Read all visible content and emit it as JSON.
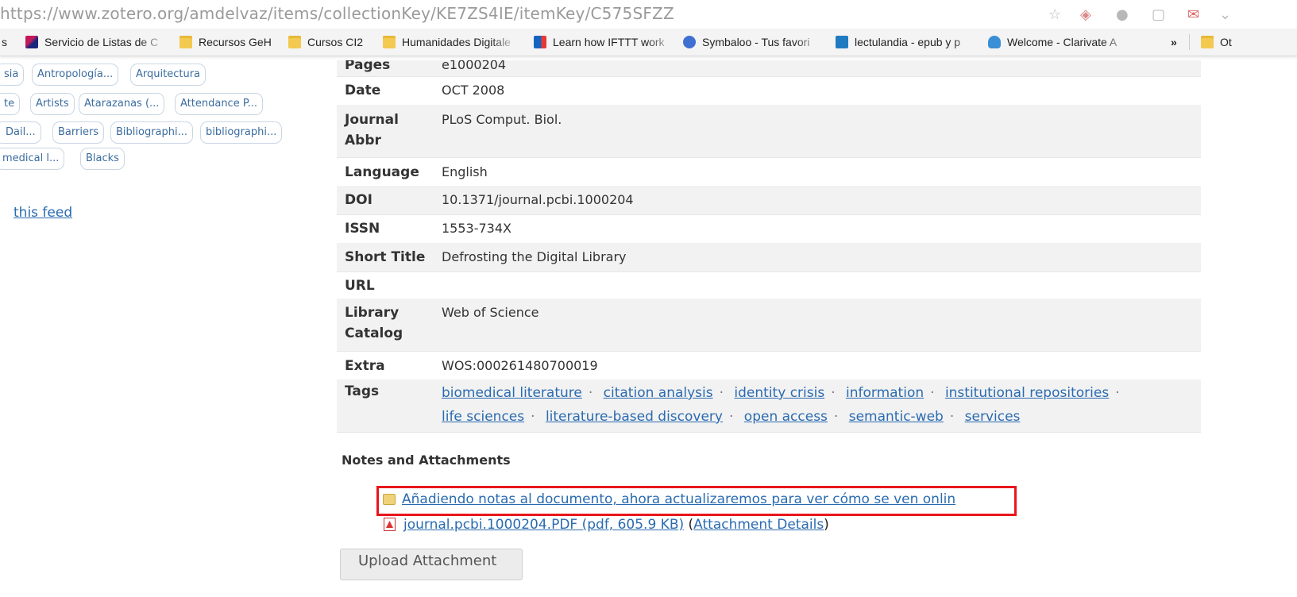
{
  "browser": {
    "url": "https://www.zotero.org/amdelvaz/items/collectionKey/KE7ZS4IE/itemKey/C575SFZZ",
    "bookmarks": [
      {
        "label": "s",
        "icon": "bookmark-icon"
      },
      {
        "label": "Servicio de Listas de C",
        "icon": "feather-icon"
      },
      {
        "label": "Recursos GeH",
        "icon": "folder-icon"
      },
      {
        "label": "Cursos CI2",
        "icon": "folder-icon"
      },
      {
        "label": "Humanidades Digitale",
        "icon": "folder-icon"
      },
      {
        "label": "Learn how IFTTT work",
        "icon": "ifttt-icon"
      },
      {
        "label": "Symbaloo - Tus favori",
        "icon": "symbaloo-icon"
      },
      {
        "label": "lectulandia - epub y p",
        "icon": "lectulandia-icon"
      },
      {
        "label": "Welcome - Clarivate A",
        "icon": "cloud-icon"
      },
      {
        "label": "»",
        "icon": "chevron-icon"
      },
      {
        "label": "Ot",
        "icon": "folder-icon"
      }
    ]
  },
  "sidebar": {
    "tags": [
      [
        "sia",
        "Antropología...",
        "Arquitectura"
      ],
      [
        "te",
        "Artists",
        "Atarazanas (...",
        "Attendance P..."
      ],
      [
        "Dail...",
        "Barriers",
        "Bibliographi...",
        "bibliographi..."
      ],
      [
        "medical l...",
        "Blacks"
      ]
    ],
    "feed_link": "this feed"
  },
  "item": {
    "fields": [
      {
        "label": "Pages",
        "value": "e1000204"
      },
      {
        "label": "Date",
        "value": "OCT 2008"
      },
      {
        "label": "Journal Abbr",
        "value": "PLoS Comput. Biol."
      },
      {
        "label": "Language",
        "value": "English"
      },
      {
        "label": "DOI",
        "value": "10.1371/journal.pcbi.1000204"
      },
      {
        "label": "ISSN",
        "value": "1553-734X"
      },
      {
        "label": "Short Title",
        "value": "Defrosting the Digital Library"
      },
      {
        "label": "URL",
        "value": ""
      },
      {
        "label": "Library Catalog",
        "value": "Web of Science"
      },
      {
        "label": "Extra",
        "value": "WOS:000261480700019"
      },
      {
        "label": "Tags",
        "value": ""
      }
    ],
    "tags": [
      "biomedical literature",
      "citation analysis",
      "identity crisis",
      "information",
      "institutional repositories",
      "life sciences",
      "literature-based discovery",
      "open access",
      "semantic-web",
      "services"
    ]
  },
  "notes": {
    "heading": "Notes and Attachments",
    "note": "Añadiendo notas al documento, ahora actualizaremos para ver cómo se ven onlin",
    "attachment": "journal.pcbi.1000204.PDF (pdf, 605.9 KB)",
    "attachment_details": "Attachment Details",
    "upload_button": "Upload Attachment"
  },
  "colors": {
    "link": "#2a6bb0",
    "highlight": "#e8161b"
  }
}
